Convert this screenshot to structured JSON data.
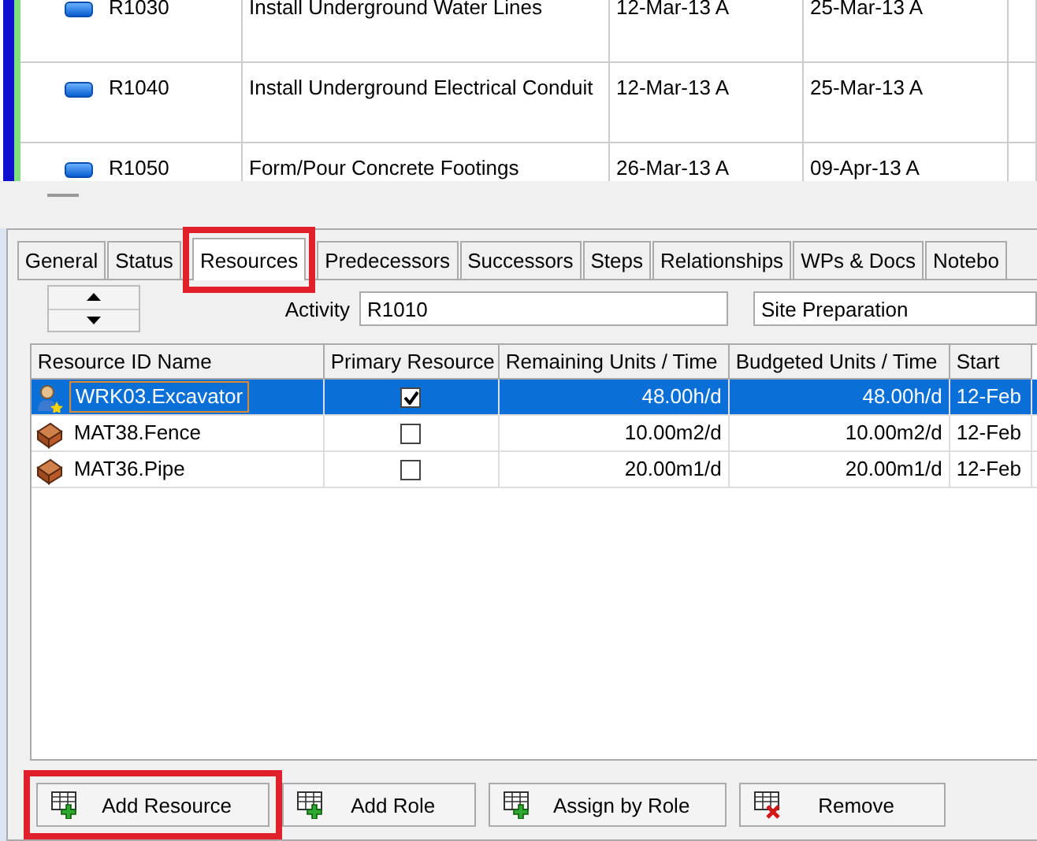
{
  "activities": {
    "rows": [
      {
        "id": "R1030",
        "name": "Install Underground Water Lines",
        "start": "12-Mar-13 A",
        "finish": "25-Mar-13 A"
      },
      {
        "id": "R1040",
        "name": "Install Underground Electrical Conduit",
        "start": "12-Mar-13 A",
        "finish": "25-Mar-13 A"
      },
      {
        "id": "R1050",
        "name": "Form/Pour Concrete Footings",
        "start": "26-Mar-13 A",
        "finish": "09-Apr-13 A"
      }
    ]
  },
  "tabs": [
    {
      "label": "General",
      "selected": false,
      "highlighted": false
    },
    {
      "label": "Status",
      "selected": false,
      "highlighted": false
    },
    {
      "label": "Resources",
      "selected": true,
      "highlighted": true
    },
    {
      "label": "Predecessors",
      "selected": false,
      "highlighted": false
    },
    {
      "label": "Successors",
      "selected": false,
      "highlighted": false
    },
    {
      "label": "Steps",
      "selected": false,
      "highlighted": false
    },
    {
      "label": "Relationships",
      "selected": false,
      "highlighted": false
    },
    {
      "label": "WPs & Docs",
      "selected": false,
      "highlighted": false
    },
    {
      "label": "Notebo",
      "selected": false,
      "highlighted": false
    }
  ],
  "activity": {
    "label": "Activity",
    "id": "R1010",
    "name": "Site Preparation"
  },
  "resources": {
    "columns": [
      "Resource ID Name",
      "Primary Resource",
      "Remaining Units / Time",
      "Budgeted Units / Time",
      "Start"
    ],
    "rows": [
      {
        "kind": "labor",
        "name": "WRK03.Excavator",
        "primary": true,
        "remaining": "48.00h/d",
        "budgeted": "48.00h/d",
        "start": "12-Feb",
        "selected": true
      },
      {
        "kind": "material",
        "name": "MAT38.Fence",
        "primary": false,
        "remaining": "10.00m2/d",
        "budgeted": "10.00m2/d",
        "start": "12-Feb",
        "selected": false
      },
      {
        "kind": "material",
        "name": "MAT36.Pipe",
        "primary": false,
        "remaining": "20.00m1/d",
        "budgeted": "20.00m1/d",
        "start": "12-Feb",
        "selected": false
      }
    ]
  },
  "buttons": [
    {
      "label": "Add Resource",
      "kind": "add",
      "highlighted": true
    },
    {
      "label": "Add Role",
      "kind": "add",
      "highlighted": false
    },
    {
      "label": "Assign by Role",
      "kind": "add",
      "highlighted": false
    },
    {
      "label": "Remove",
      "kind": "remove",
      "highlighted": false
    }
  ]
}
